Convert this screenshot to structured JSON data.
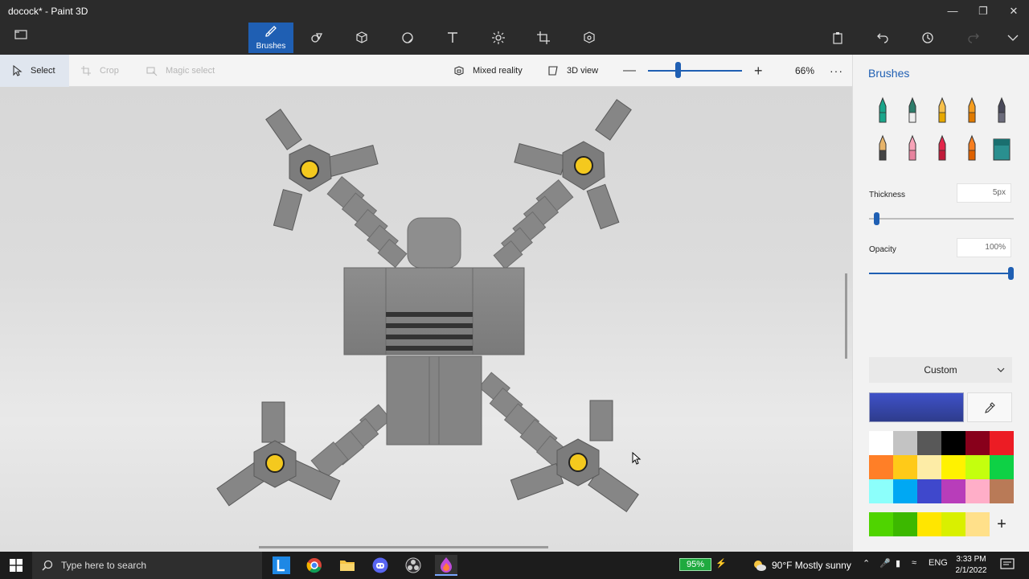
{
  "window": {
    "title": "docock* - Paint 3D"
  },
  "toolbar": {
    "brushes_label": "Brushes"
  },
  "subtoolbar": {
    "select_label": "Select",
    "crop_label": "Crop",
    "magic_select_label": "Magic select",
    "mixed_reality_label": "Mixed reality",
    "view3d_label": "3D view",
    "zoom_value": "66%",
    "zoom_fraction": 0.29
  },
  "panel": {
    "title": "Brushes",
    "thickness_label": "Thickness",
    "thickness_value": "5px",
    "opacity_label": "Opacity",
    "opacity_value": "100%",
    "color_mode": "Custom",
    "current_color": "#3f51c8",
    "brush_icons": [
      "marker-icon",
      "calligraphy-pen-icon",
      "oil-brush-icon",
      "watercolor-icon",
      "pixel-pen-icon",
      "pencil-icon",
      "eraser-icon",
      "crayon-icon",
      "spray-can-icon",
      "fill-bucket-icon"
    ],
    "palette": [
      "#ffffff",
      "#c3c3c3",
      "#585858",
      "#000000",
      "#88001b",
      "#ec1c24",
      "#ff7f27",
      "#ffca18",
      "#fdeca6",
      "#fff200",
      "#c4ff0e",
      "#0ed145",
      "#8cfffb",
      "#00a8f3",
      "#3f48cc",
      "#b83dba",
      "#ffaec8",
      "#b97a57"
    ],
    "custom_palette": [
      "#4fd400",
      "#3cb800",
      "#ffe600",
      "#d9f000",
      "#ffe08a"
    ]
  },
  "taskbar": {
    "search_placeholder": "Type here to search",
    "battery": "95%",
    "weather": "90°F  Mostly sunny",
    "language": "ENG",
    "time": "3:33 PM",
    "date": "2/1/2022"
  }
}
